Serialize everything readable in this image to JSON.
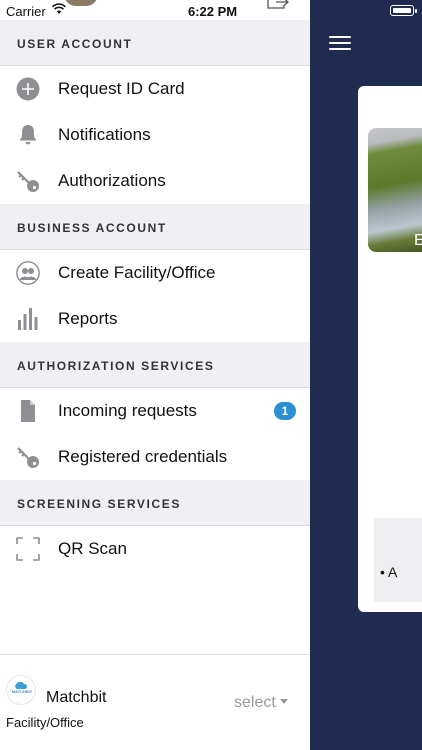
{
  "status_bar": {
    "carrier": "Carrier",
    "time": "6:22 PM"
  },
  "sections": {
    "user_account": {
      "title": "USER ACCOUNT",
      "items": [
        {
          "label": "Request ID Card",
          "icon": "plus-circle-icon"
        },
        {
          "label": "Notifications",
          "icon": "bell-icon"
        },
        {
          "label": "Authorizations",
          "icon": "key-icon"
        }
      ]
    },
    "business_account": {
      "title": "BUSINESS ACCOUNT",
      "items": [
        {
          "label": "Create Facility/Office",
          "icon": "users-icon"
        },
        {
          "label": "Reports",
          "icon": "bar-chart-icon"
        }
      ]
    },
    "authorization_services": {
      "title": "AUTHORIZATION SERVICES",
      "items": [
        {
          "label": "Incoming requests",
          "icon": "document-icon",
          "badge": "1"
        },
        {
          "label": "Registered credentials",
          "icon": "key-icon"
        }
      ]
    },
    "screening_services": {
      "title": "SCREENING SERVICES",
      "items": [
        {
          "label": "QR Scan",
          "icon": "qr-scan-icon"
        }
      ]
    }
  },
  "footer": {
    "logo_text": "MATCHBIT",
    "org_name": "Matchbit",
    "org_type": "Facility/Office",
    "select_label": "select"
  },
  "background_app": {
    "photo_label": "E",
    "bullet_text": "• A"
  },
  "colors": {
    "nav_background": "#1f2b50",
    "section_header_bg": "#efeff4",
    "badge": "#2c8fd1",
    "icon_gray": "#8e8e93"
  }
}
